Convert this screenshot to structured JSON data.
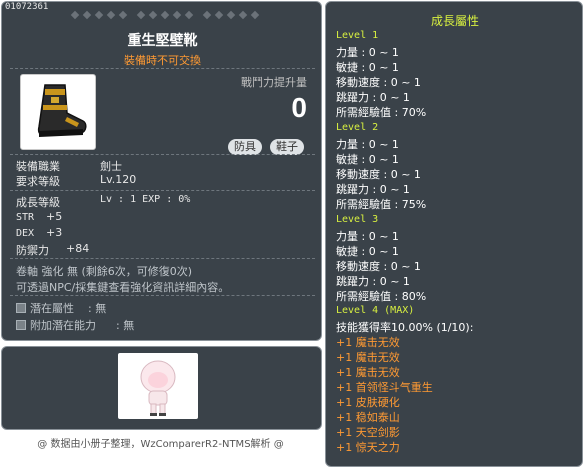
{
  "item": {
    "id": "01072361",
    "name": "重生堅壁靴",
    "subtitle": "裝備時不可交換",
    "power_label": "戰鬥力提升量",
    "power_value": "0",
    "tags": [
      "防具",
      "鞋子"
    ],
    "job_label": "裝備職業",
    "job_value": "劍士",
    "req_level_label": "要求等級",
    "req_level_value": "Lv.120",
    "grow_label": "成長等級",
    "grow_value": "Lv : 1  EXP : 0%",
    "stats": [
      {
        "name": "STR",
        "value": "+5"
      },
      {
        "name": "DEX",
        "value": "+3"
      },
      {
        "name": "防禦力",
        "value": "+84"
      }
    ],
    "scroll_text": "卷軸 強化 無 (剩餘6次，可修復0次)",
    "npc_text": "可透過NPC/採集鍵查看強化資訊詳細內容。",
    "potential": {
      "label": "潛在屬性",
      "value": ": 無"
    },
    "extra_potential": {
      "label": "附加潛在能力",
      "value": ": 無"
    },
    "footer": "@ 数据由小册子整理，WzComparerR2-NTMS解析 @"
  },
  "growth": {
    "title": "成長屬性",
    "levels": [
      {
        "label": "Level 1",
        "lines": [
          "力量 : 0 ~ 1",
          "敏捷 : 0 ~ 1",
          "移動速度 : 0 ~ 1",
          "跳躍力 : 0 ~ 1",
          "所需經驗值 : 70%"
        ]
      },
      {
        "label": "Level 2",
        "lines": [
          "力量 : 0 ~ 1",
          "敏捷 : 0 ~ 1",
          "移動速度 : 0 ~ 1",
          "跳躍力 : 0 ~ 1",
          "所需經驗值 : 75%"
        ]
      },
      {
        "label": "Level 3",
        "lines": [
          "力量 : 0 ~ 1",
          "敏捷 : 0 ~ 1",
          "移動速度 : 0 ~ 1",
          "跳躍力 : 0 ~ 1",
          "所需經驗值 : 80%"
        ]
      },
      {
        "label": "Level 4 (MAX)",
        "lines": [
          "技能獲得率10.00% (1/10):"
        ]
      }
    ],
    "skills": [
      "+1 魔击无效",
      "+1 魔击无效",
      "+1 魔击无效",
      "+1 首领怪斗气重生",
      "+1 皮肤硬化",
      "+1 稳如泰山",
      "+1 天空剑影",
      "+1 惊天之力"
    ]
  },
  "colors": {
    "panel": "#3a4249",
    "level": "#d8f040",
    "skill": "#ff9a33"
  }
}
